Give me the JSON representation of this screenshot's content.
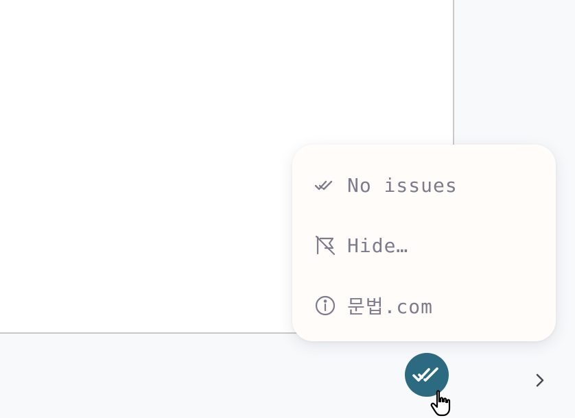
{
  "editor": {},
  "menu": {
    "items": [
      {
        "label": "No issues",
        "icon": "double-check-icon"
      },
      {
        "label": "Hide…",
        "icon": "flag-off-icon"
      },
      {
        "label": "문법.com",
        "icon": "info-circle-icon"
      }
    ]
  },
  "status": {
    "icon": "double-check-icon",
    "color": "#2b6a80"
  },
  "nav": {
    "next_icon": "chevron-right-icon"
  },
  "colors": {
    "menu_text": "#7d7c8c",
    "menu_background": "#fffcf9",
    "status_button": "#2b6a80"
  }
}
